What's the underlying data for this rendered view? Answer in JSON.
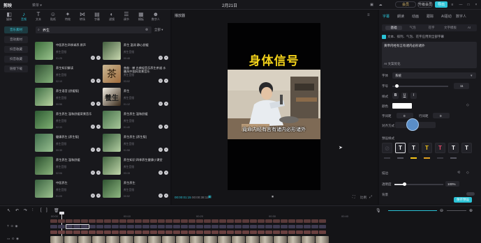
{
  "app": {
    "logo": "剪映",
    "project_title": "2月21日"
  },
  "titlebar": {
    "pro_badge": "会员",
    "upgrade": "升级会员",
    "export": "导出",
    "controls": [
      "—",
      "□",
      "×"
    ]
  },
  "toolbar": {
    "items": [
      {
        "label": "媒体",
        "icon": "media-icon"
      },
      {
        "label": "音频",
        "icon": "audio-icon"
      },
      {
        "label": "文本",
        "icon": "text-icon"
      },
      {
        "label": "贴纸",
        "icon": "sticker-icon"
      },
      {
        "label": "特效",
        "icon": "effects-icon"
      },
      {
        "label": "转场",
        "icon": "transition-icon"
      },
      {
        "label": "字幕",
        "icon": "caption-icon"
      },
      {
        "label": "滤镜",
        "icon": "filter-icon"
      },
      {
        "label": "调节",
        "icon": "adjust-icon"
      },
      {
        "label": "模板",
        "icon": "template-icon"
      },
      {
        "label": "数字人",
        "icon": "avatar-icon"
      }
    ]
  },
  "categories": [
    "音乐素材",
    "音效素材",
    "抖音收藏",
    "抖音收藏",
    "链接下载"
  ],
  "search": {
    "value": "养生",
    "filter": "全部"
  },
  "cards": [
    {
      "title": "中医养生四季调养 原声",
      "sub": "养生音频",
      "dur": "01:25"
    },
    {
      "title": "养生 温润 静心舒缓",
      "sub": "养生音频",
      "dur": "00:48"
    },
    {
      "title": "养生知识解读",
      "sub": "养生音频",
      "dur": "02:10"
    },
    {
      "title": "茶韵 · 禅 古典轻音乐养生茶道 水墨风中国风背景音乐",
      "sub": "养生音频",
      "dur": "03:02"
    },
    {
      "title": "养生语音 (舒缓版)",
      "sub": "养生音频",
      "dur": "00:56"
    },
    {
      "title": "养生",
      "sub": "养生音频",
      "dur": "01:12"
    },
    {
      "title": "养生养生 温和舒缓背景音乐",
      "sub": "养生音频",
      "dur": "02:33"
    },
    {
      "title": "养生养生 温和舒缓",
      "sub": "养生音频",
      "dur": "01:40"
    },
    {
      "title": "健康养生 (养生版)",
      "sub": "养生音频",
      "dur": "00:39"
    },
    {
      "title": "养生养生 (养生版)",
      "sub": "养生音频",
      "dur": "01:58"
    },
    {
      "title": "养生养生 温和舒缓",
      "sub": "养生音频",
      "dur": "02:06"
    },
    {
      "title": "养生知识 四季养生健康小课堂",
      "sub": "养生音频",
      "dur": "03:15"
    },
    {
      "title": "中医养生",
      "sub": "养生音频",
      "dur": "01:05"
    },
    {
      "title": "养生养生",
      "sub": "养生音频",
      "dur": "00:52"
    }
  ],
  "player": {
    "title": "播放器",
    "overlay_title": "身体信号",
    "subtitle": "竟命内经有言有诸内必形诸外",
    "time": "00:00:01:15",
    "duration": "00:00:38:12",
    "ratio": "比例",
    "play_icon": "play-icon"
  },
  "right": {
    "tabs": [
      "字幕",
      "朗读",
      "动画",
      "跟踪",
      "AI驱动",
      "数字人"
    ],
    "subtabs": [
      "基础",
      "气泡",
      "花字",
      "文字模板",
      "AI"
    ],
    "checkbox": "文本、排列、气泡、花字应用到全部字幕",
    "textarea": "黄帝内经有言有诸内必形诸外",
    "ai_btn": "AI 文案优化",
    "font_label": "字体",
    "font_value": "系统",
    "size_label": "字号",
    "size_value": "11",
    "style_label": "样式",
    "color_label": "颜色",
    "char_spacing": "字间距",
    "line_spacing": "行间距",
    "spacing_vals": [
      "0",
      "0"
    ],
    "align_label": "对齐方式",
    "preset_label": "预设样式",
    "stroke_label": "描边",
    "opacity_label": "透明度",
    "opacity_value": "100%",
    "bg_label": "背景",
    "save_preset": "保存预设"
  },
  "timeline": {
    "marks": [
      "00:00",
      "00:10",
      "00:20",
      "00:30",
      "00:40"
    ]
  }
}
